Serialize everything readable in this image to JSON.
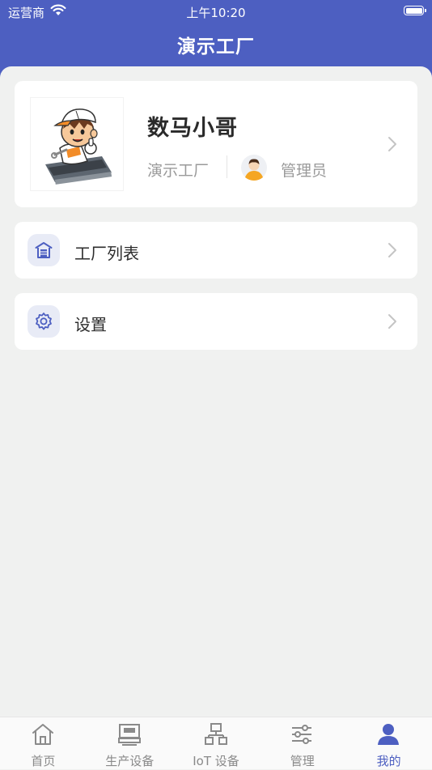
{
  "status_bar": {
    "carrier": "运营商",
    "time": "上午10:20",
    "wifi_icon": "wifi-icon",
    "battery_icon": "battery-icon"
  },
  "header": {
    "title": "演示工厂",
    "background": "#4d5fc1"
  },
  "profile": {
    "name": "数马小哥",
    "factory": "演示工厂",
    "role": "管理员",
    "avatar_icon": "mascot-avatar-icon",
    "role_icon": "user-avatar-icon"
  },
  "menu": [
    {
      "label": "工厂列表",
      "icon": "factory-icon"
    },
    {
      "label": "设置",
      "icon": "gear-icon"
    }
  ],
  "tabs": [
    {
      "label": "首页",
      "icon": "home-icon",
      "active": false
    },
    {
      "label": "生产设备",
      "icon": "machine-icon",
      "active": false
    },
    {
      "label": "IoT 设备",
      "icon": "network-icon",
      "active": false
    },
    {
      "label": "管理",
      "icon": "sliders-icon",
      "active": false
    },
    {
      "label": "我的",
      "icon": "person-icon",
      "active": true
    }
  ],
  "colors": {
    "accent": "#4d5fc1",
    "tab_inactive": "#8a8a8a",
    "background": "#f0f1f0"
  }
}
